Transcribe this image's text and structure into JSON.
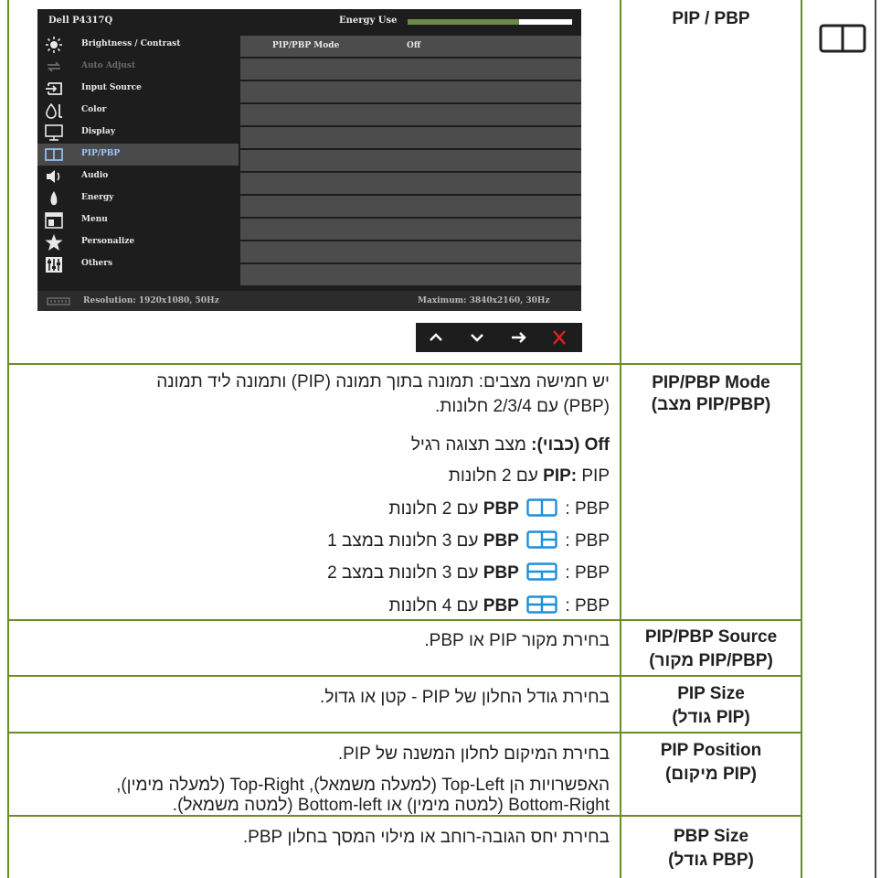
{
  "osd": {
    "model": "Dell P4317Q",
    "energy_label": "Energy Use",
    "energy_level": 0.68,
    "menu": [
      {
        "label": "Brightness / Contrast",
        "icon": "brightness-icon",
        "state": "normal"
      },
      {
        "label": "Auto Adjust",
        "icon": "auto-adjust-icon",
        "state": "disabled"
      },
      {
        "label": "Input Source",
        "icon": "input-source-icon",
        "state": "normal"
      },
      {
        "label": "Color",
        "icon": "color-icon",
        "state": "normal"
      },
      {
        "label": "Display",
        "icon": "display-icon",
        "state": "normal"
      },
      {
        "label": "PIP/PBP",
        "icon": "pip-pbp-icon",
        "state": "selected"
      },
      {
        "label": "Audio",
        "icon": "audio-icon",
        "state": "normal"
      },
      {
        "label": "Energy",
        "icon": "energy-icon",
        "state": "normal"
      },
      {
        "label": "Menu",
        "icon": "menu-icon",
        "state": "normal"
      },
      {
        "label": "Personalize",
        "icon": "star-icon",
        "state": "normal"
      },
      {
        "label": "Others",
        "icon": "others-icon",
        "state": "normal"
      }
    ],
    "setting": {
      "label": "PIP/PBP Mode",
      "value": "Off"
    },
    "footer_left": "Resolution: 1920x1080, 50Hz",
    "footer_right": "Maximum: 3840x2160, 30Hz",
    "nav_buttons": [
      "up-icon",
      "down-icon",
      "right-arrow-icon",
      "exit-icon"
    ],
    "colors": {
      "accent": "#9cc8ff",
      "exit": "#e02020",
      "energy": "#6e8a4a"
    }
  },
  "header": {
    "title": "PIP / PBP",
    "icon": "pip-pbp-icon"
  },
  "mode": {
    "title_en": "PIP/PBP Mode",
    "title_he": "(מצב PIP/PBP)",
    "desc_line1": "יש חמישה מצבים: תמונה בתוך תמונה (PIP) ותמונה ליד תמונה",
    "desc_line2": "(PBP) עם 2/3/4 חלונות.",
    "off_bold": "Off (כבוי):",
    "off_text": " מצב תצוגה רגיל",
    "pip_bold": "PIP:",
    "pip_text": " PIP עם 2 חלונות",
    "pbp_bold": "PBP",
    "pbp2_text": " : PBP עם 2 חלונות",
    "pbp3a_text": " : PBP עם 3 חלונות במצב 1",
    "pbp3b_text": " : PBP עם 3 חלונות במצב 2",
    "pbp4_text": " : PBP עם 4 חלונות",
    "glyph_color": "#1f8fd6"
  },
  "source": {
    "title_en": "PIP/PBP Source",
    "title_he": "(מקור PIP/PBP)",
    "desc": "בחירת מקור PIP או PBP."
  },
  "size": {
    "title_en": "PIP Size",
    "title_he": "(גודל PIP)",
    "desc": "בחירת גודל החלון של PIP - קטן או גדול."
  },
  "position": {
    "title_en": "PIP Position",
    "title_he": "(מיקום PIP)",
    "desc_line1": "בחירת המיקום לחלון המשנה של PIP.",
    "desc_line2": "האפשרויות הן Top-Left (למעלה משמאל), Top-Right (למעלה מימין),",
    "desc_line3": "Bottom-Right (למטה מימין) או Bottom-left (למטה משמאל)."
  },
  "pbp_size": {
    "title_en": "PBP Size",
    "title_he": "(גודל PBP)",
    "desc": "בחירת יחס הגובה-רוחב או מילוי המסך בחלון PBP."
  }
}
